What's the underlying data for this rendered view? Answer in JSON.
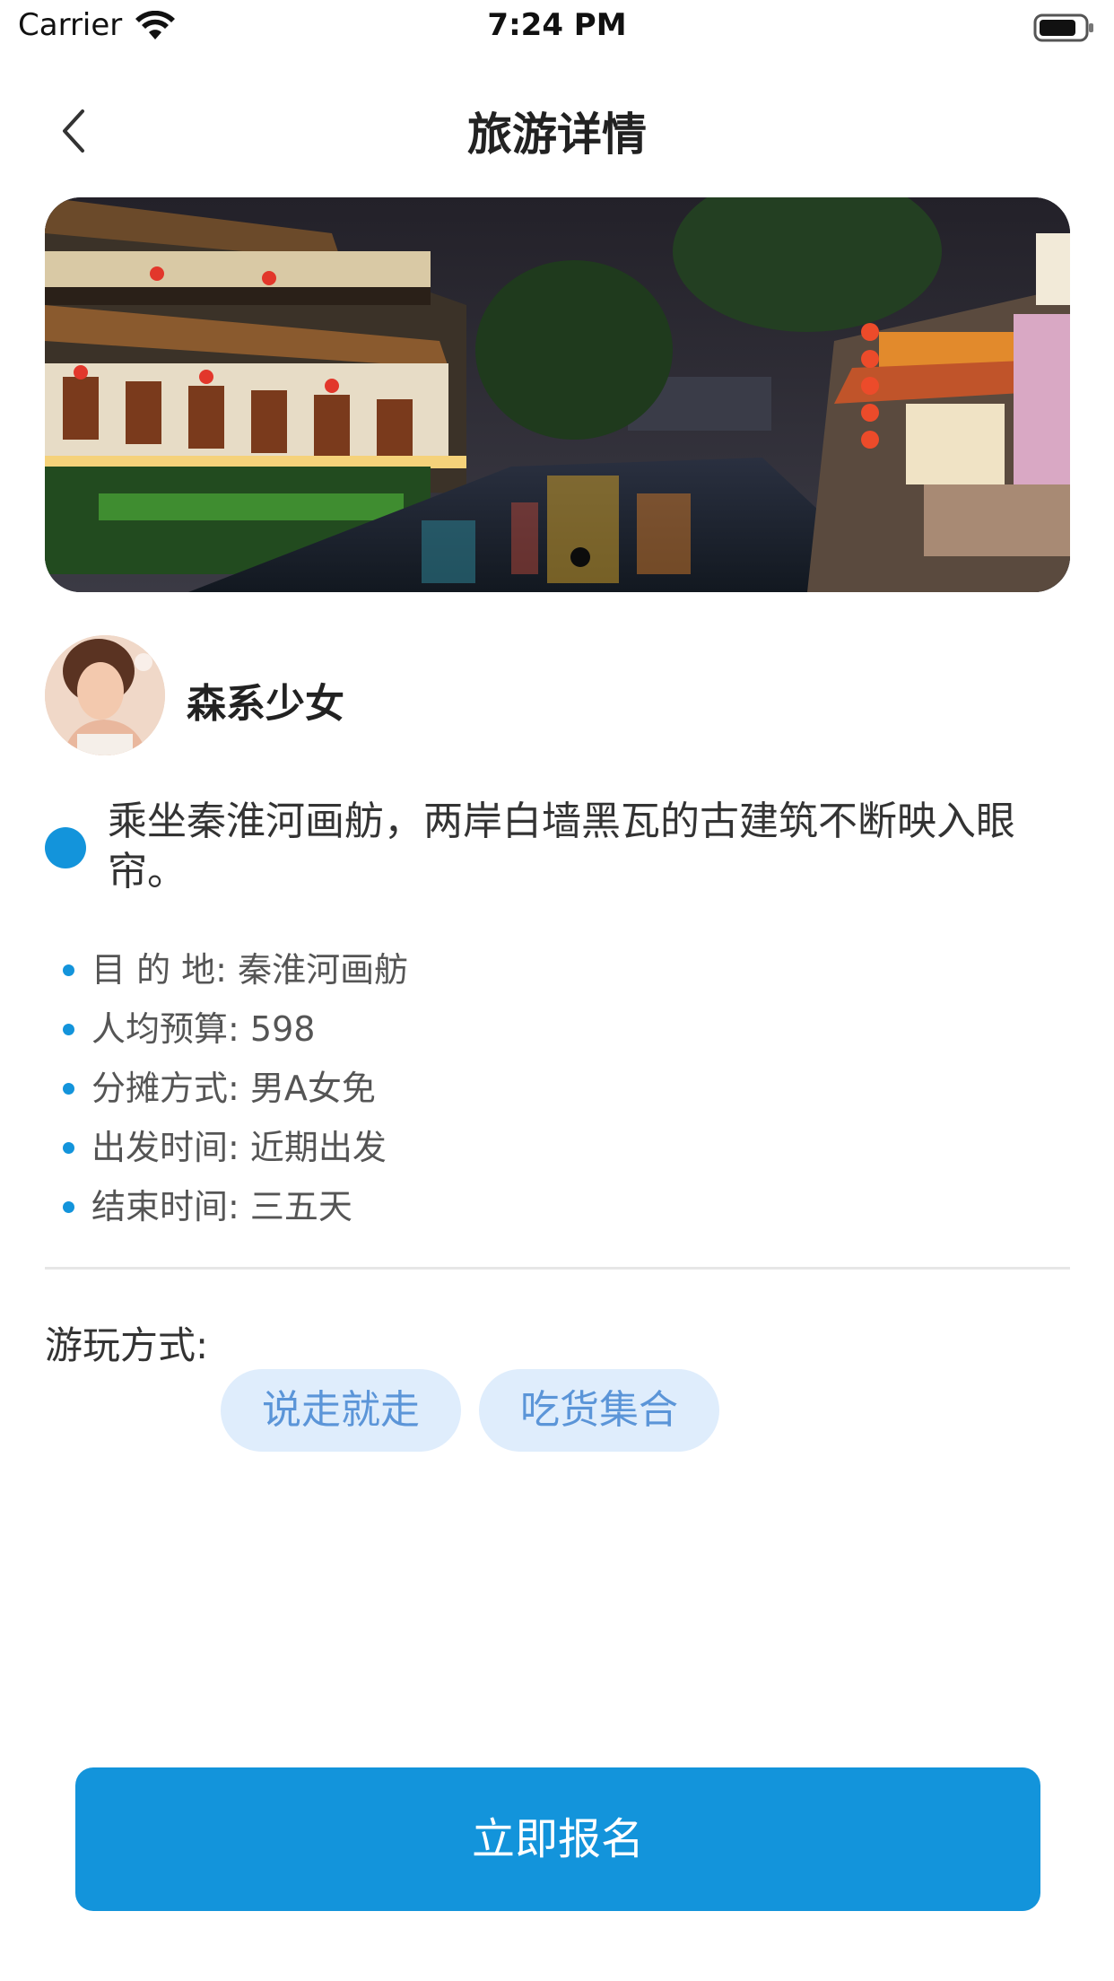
{
  "status_bar": {
    "carrier": "Carrier",
    "time": "7:24 PM",
    "icons": [
      "wifi-icon",
      "battery-icon"
    ]
  },
  "nav": {
    "title": "旅游详情",
    "back_icon": "chevron-left-icon"
  },
  "banner": {
    "image": "qinhuai-river-night-scene",
    "page_count": 1,
    "current_page": 1
  },
  "user": {
    "name": "森系少女",
    "avatar": "user-avatar-photo"
  },
  "description": "乘坐秦淮河画舫，两岸白墙黑瓦的古建筑不断映入眼帘。",
  "details": [
    {
      "label": "目 的 地",
      "value": "秦淮河画舫"
    },
    {
      "label": "人均预算",
      "value": "598"
    },
    {
      "label": "分摊方式",
      "value": "男A女免"
    },
    {
      "label": "出发时间",
      "value": "近期出发"
    },
    {
      "label": "结束时间",
      "value": "三五天"
    }
  ],
  "play_style": {
    "label": "游玩方式:",
    "tags": [
      "说走就走",
      "吃货集合"
    ]
  },
  "cta": {
    "label": "立即报名"
  },
  "colors": {
    "accent": "#1394db",
    "tag_bg": "#dfedfc",
    "tag_text": "#5b95d8"
  }
}
